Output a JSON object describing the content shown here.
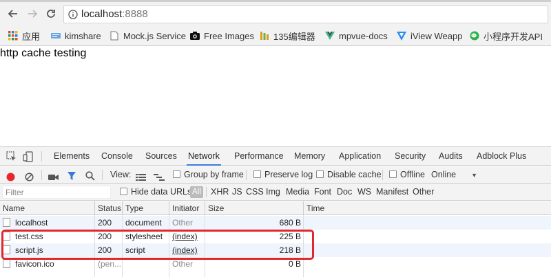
{
  "browser": {
    "url_host": "localhost",
    "url_port": ":8888",
    "bookmarks": [
      {
        "label": "应用",
        "icon": "apps-grid-icon"
      },
      {
        "label": "kimshare",
        "icon": "kimshare-icon"
      },
      {
        "label": "Mock.js Service",
        "icon": "page-icon"
      },
      {
        "label": "Free Images",
        "icon": "camera-icon"
      },
      {
        "label": "135编辑器",
        "icon": "editor-icon"
      },
      {
        "label": "mpvue-docs",
        "icon": "vue-icon"
      },
      {
        "label": "iView Weapp",
        "icon": "iview-icon"
      },
      {
        "label": "小程序开发API",
        "icon": "wechat-icon"
      }
    ]
  },
  "page": {
    "text": "http cache testing"
  },
  "devtools": {
    "tabs": [
      "Elements",
      "Console",
      "Sources",
      "Network",
      "Performance",
      "Memory",
      "Application",
      "Security",
      "Audits",
      "Adblock Plus"
    ],
    "active_tab": "Network",
    "toolbar": {
      "view_label": "View:",
      "group_by_frame": "Group by frame",
      "preserve_log": "Preserve log",
      "disable_cache": "Disable cache",
      "offline": "Offline",
      "throttle": "Online"
    },
    "filter": {
      "placeholder": "Filter",
      "hide_data_urls": "Hide data URLs",
      "types": [
        "All",
        "XHR",
        "JS",
        "CSS",
        "Img",
        "Media",
        "Font",
        "Doc",
        "WS",
        "Manifest",
        "Other"
      ]
    },
    "columns": [
      "Name",
      "Status",
      "Type",
      "Initiator",
      "Size",
      "Time"
    ],
    "rows": [
      {
        "name": "localhost",
        "status": "200",
        "type": "document",
        "initiator": "Other",
        "size": "680 B"
      },
      {
        "name": "test.css",
        "status": "200",
        "type": "stylesheet",
        "initiator": "(index)",
        "size": "225 B"
      },
      {
        "name": "script.js",
        "status": "200",
        "type": "script",
        "initiator": "(index)",
        "size": "218 B"
      },
      {
        "name": "favicon.ico",
        "status": "(pen...",
        "type": "",
        "initiator": "Other",
        "size": "0 B"
      }
    ],
    "colors": {
      "record": "#e8262c",
      "active_tab_underline": "#3879d9",
      "highlight_box": "#e0282c"
    }
  }
}
